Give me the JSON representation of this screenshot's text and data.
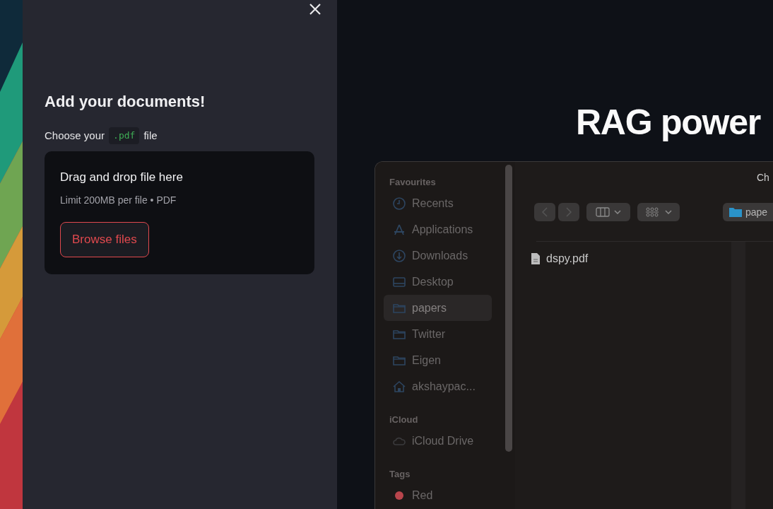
{
  "sidebar": {
    "heading": "Add your documents!",
    "label_before": "Choose your",
    "label_code": ".pdf",
    "label_after": "file",
    "uploader": {
      "title": "Drag and drop file here",
      "limit": "Limit 200MB per file • PDF",
      "button": "Browse files"
    }
  },
  "main": {
    "title": "RAG power"
  },
  "file_dialog": {
    "title": "Ch",
    "path": "pape",
    "sections": [
      {
        "header": "Favourites",
        "items": [
          {
            "kind": "clock",
            "label": "Recents",
            "selected": false
          },
          {
            "kind": "apps",
            "label": "Applications",
            "selected": false
          },
          {
            "kind": "download",
            "label": "Downloads",
            "selected": false
          },
          {
            "kind": "desktop",
            "label": "Desktop",
            "selected": false
          },
          {
            "kind": "folder",
            "label": "papers",
            "selected": true
          },
          {
            "kind": "folder",
            "label": "Twitter",
            "selected": false
          },
          {
            "kind": "folder",
            "label": "Eigen",
            "selected": false
          },
          {
            "kind": "home",
            "label": "akshaypac...",
            "selected": false
          }
        ]
      },
      {
        "header": "iCloud",
        "items": [
          {
            "kind": "cloud",
            "label": "iCloud Drive",
            "selected": false
          }
        ]
      },
      {
        "header": "Tags",
        "items": [
          {
            "kind": "tag",
            "label": "Red",
            "selected": false,
            "color": "#b8454c"
          }
        ]
      }
    ],
    "files": [
      {
        "name": "dspy.pdf"
      }
    ]
  }
}
